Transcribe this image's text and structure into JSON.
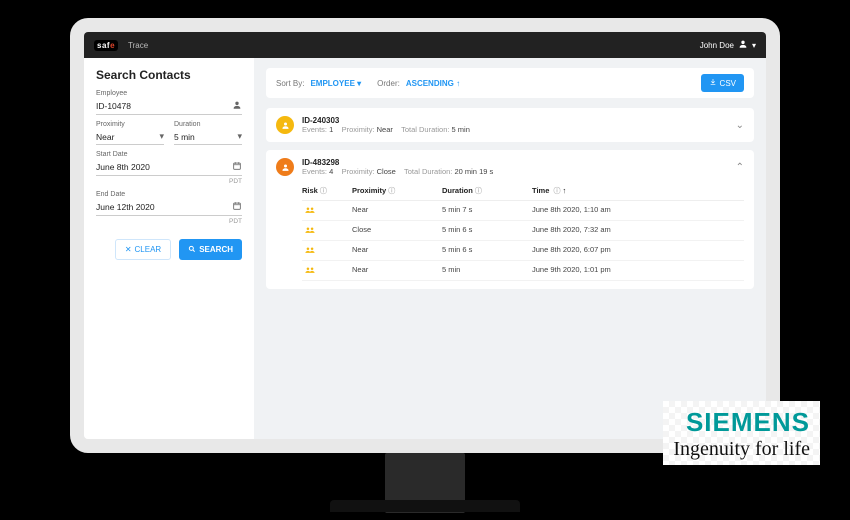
{
  "topbar": {
    "brand": "saf",
    "brand_suffix": "e",
    "section": "Trace",
    "user": "John Doe"
  },
  "sidebar": {
    "title": "Search Contacts",
    "employee": {
      "label": "Employee",
      "value": "ID-10478"
    },
    "proximity": {
      "label": "Proximity",
      "value": "Near"
    },
    "duration": {
      "label": "Duration",
      "value": "5 min"
    },
    "start_date": {
      "label": "Start Date",
      "value": "June 8th 2020",
      "tz": "PDT"
    },
    "end_date": {
      "label": "End Date",
      "value": "June 12th 2020",
      "tz": "PDT"
    },
    "clear_label": "CLEAR",
    "search_label": "SEARCH"
  },
  "sortbar": {
    "sort_by_label": "Sort By:",
    "sort_by_value": "EMPLOYEE",
    "order_label": "Order:",
    "order_value": "ASCENDING",
    "csv_label": "CSV"
  },
  "results": [
    {
      "id": "ID-240303",
      "events_label": "Events:",
      "events": "1",
      "proximity_label": "Proximity:",
      "proximity": "Near",
      "duration_label": "Total Duration:",
      "duration": "5 min",
      "expanded": false,
      "color": "yellow"
    },
    {
      "id": "ID-483298",
      "events_label": "Events:",
      "events": "4",
      "proximity_label": "Proximity:",
      "proximity": "Close",
      "duration_label": "Total Duration:",
      "duration": "20 min 19 s",
      "expanded": true,
      "color": "orange",
      "columns": {
        "risk": "Risk",
        "proximity": "Proximity",
        "duration": "Duration",
        "time": "Time"
      },
      "rows": [
        {
          "proximity": "Near",
          "duration": "5 min 7 s",
          "time": "June 8th 2020, 1:10 am"
        },
        {
          "proximity": "Close",
          "duration": "5 min 6 s",
          "time": "June 8th 2020, 7:32 am"
        },
        {
          "proximity": "Near",
          "duration": "5 min 6 s",
          "time": "June 8th 2020, 6:07 pm"
        },
        {
          "proximity": "Near",
          "duration": "5 min",
          "time": "June 9th 2020, 1:01 pm"
        }
      ]
    }
  ],
  "siemens": {
    "logo": "SIEMENS",
    "tagline": "Ingenuity for life"
  }
}
